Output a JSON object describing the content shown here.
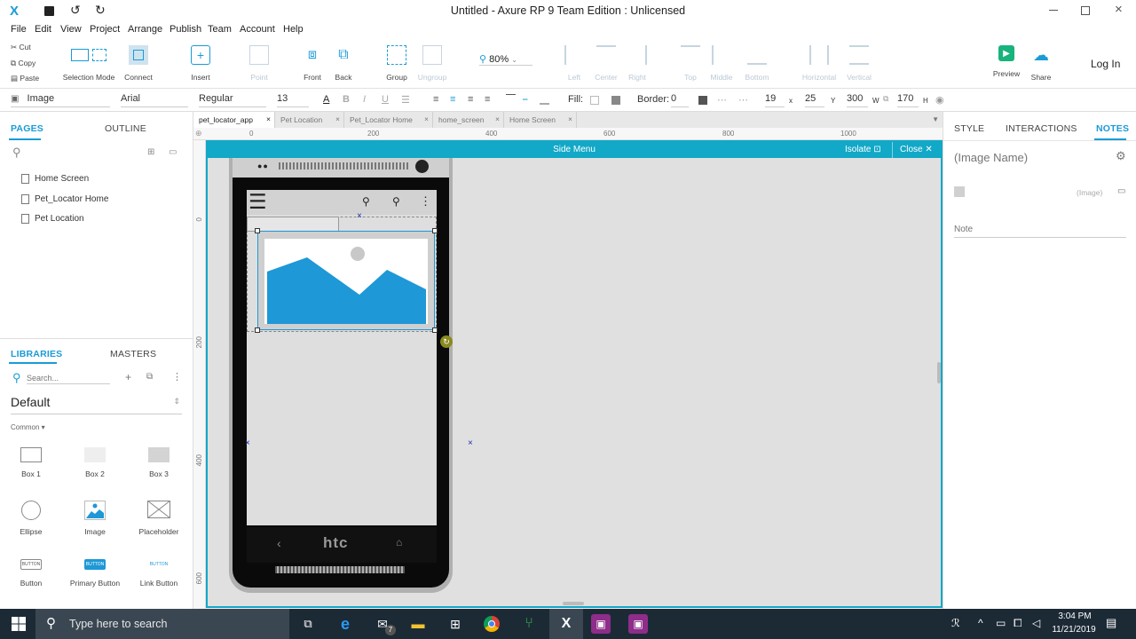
{
  "window": {
    "title": "Untitled - Axure RP 9 Team Edition : Unlicensed"
  },
  "menu": [
    "File",
    "Edit",
    "View",
    "Project",
    "Arrange",
    "Publish",
    "Team",
    "Account",
    "Help"
  ],
  "clipboard": {
    "cut": "Cut",
    "copy": "Copy",
    "paste": "Paste"
  },
  "toolbar": {
    "selection_mode": "Selection Mode",
    "connect": "Connect",
    "insert": "Insert",
    "point": "Point",
    "front": "Front",
    "back": "Back",
    "group": "Group",
    "ungroup": "Ungroup",
    "zoom": "80%",
    "left": "Left",
    "center": "Center",
    "right": "Right",
    "top": "Top",
    "middle": "Middle",
    "bottom": "Bottom",
    "horizontal": "Horizontal",
    "vertical": "Vertical",
    "preview": "Preview",
    "share": "Share",
    "login": "Log In"
  },
  "format": {
    "widget_type": "Image",
    "font": "Arial",
    "weight": "Regular",
    "size": "13",
    "fill_label": "Fill:",
    "border_label": "Border:",
    "border_value": "0",
    "x": "19",
    "x_label": "x",
    "y": "25",
    "y_label": "Y",
    "w": "300",
    "w_label": "W",
    "h": "170",
    "h_label": "H"
  },
  "left_panel": {
    "tab_pages": "PAGES",
    "tab_outline": "OUTLINE",
    "pages": [
      "Home Screen",
      "Pet_Locator Home",
      "Pet Location"
    ],
    "tab_libraries": "LIBRARIES",
    "tab_masters": "MASTERS",
    "search_placeholder": "Search...",
    "library_name": "Default",
    "section": "Common ▾",
    "widgets": [
      "Box 1",
      "Box 2",
      "Box 3",
      "Ellipse",
      "Image",
      "Placeholder",
      "Button",
      "Primary Button",
      "Link Button"
    ],
    "button_caption": "BUTTON"
  },
  "doc_tabs": [
    "pet_locator_app",
    "Pet Location",
    "Pet_Locator Home",
    "home_screen",
    "Home Screen"
  ],
  "ruler": {
    "h": [
      "0",
      "200",
      "400",
      "600",
      "800",
      "1000"
    ],
    "v": [
      "0",
      "200",
      "400",
      "600"
    ]
  },
  "canvas": {
    "title": "Side Menu",
    "isolate": "Isolate",
    "close": "Close",
    "phone_brand": "htc"
  },
  "right_panel": {
    "tab_style": "STYLE",
    "tab_interactions": "INTERACTIONS",
    "tab_notes": "NOTES",
    "name_placeholder": "(Image Name)",
    "type_label": "(Image)",
    "note_placeholder": "Note"
  },
  "taskbar": {
    "search_placeholder": "Type here to search",
    "time": "3:04 PM",
    "date": "11/21/2019",
    "badge": "7"
  },
  "colors": {
    "accent": "#12a8c7",
    "image_blue": "#1e98d6",
    "brand": "#1976d2",
    "taskbar": "#1c2a36"
  }
}
